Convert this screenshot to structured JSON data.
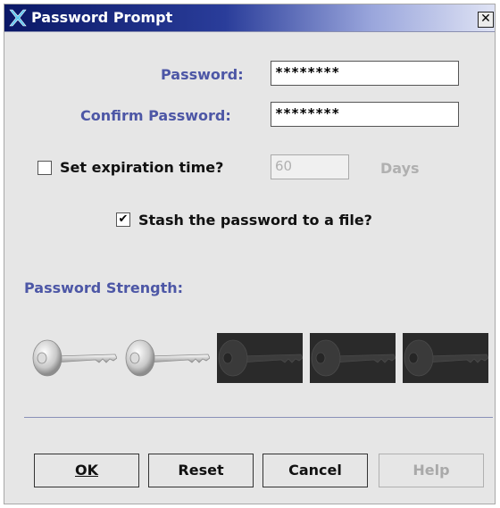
{
  "window": {
    "title": "Password Prompt",
    "close_icon": "close-icon",
    "app_icon": "x-logo-icon"
  },
  "form": {
    "password_label": "Password:",
    "password_value": "********",
    "confirm_label": "Confirm Password:",
    "confirm_value": "********",
    "expiration_label": "Set expiration time?",
    "expiration_checked": false,
    "expiration_value": "60",
    "days_label": "Days",
    "stash_label": "Stash the password to a file?",
    "stash_checked": true,
    "stash_mark": "✔"
  },
  "strength": {
    "label": "Password Strength:",
    "level": 2,
    "max": 5
  },
  "buttons": {
    "ok": "OK",
    "reset": "Reset",
    "cancel": "Cancel",
    "help": "Help"
  },
  "colors": {
    "title_gradient_start": "#0a1866",
    "label": "#4d57a6",
    "key_off_background": "#2a2a2a"
  }
}
